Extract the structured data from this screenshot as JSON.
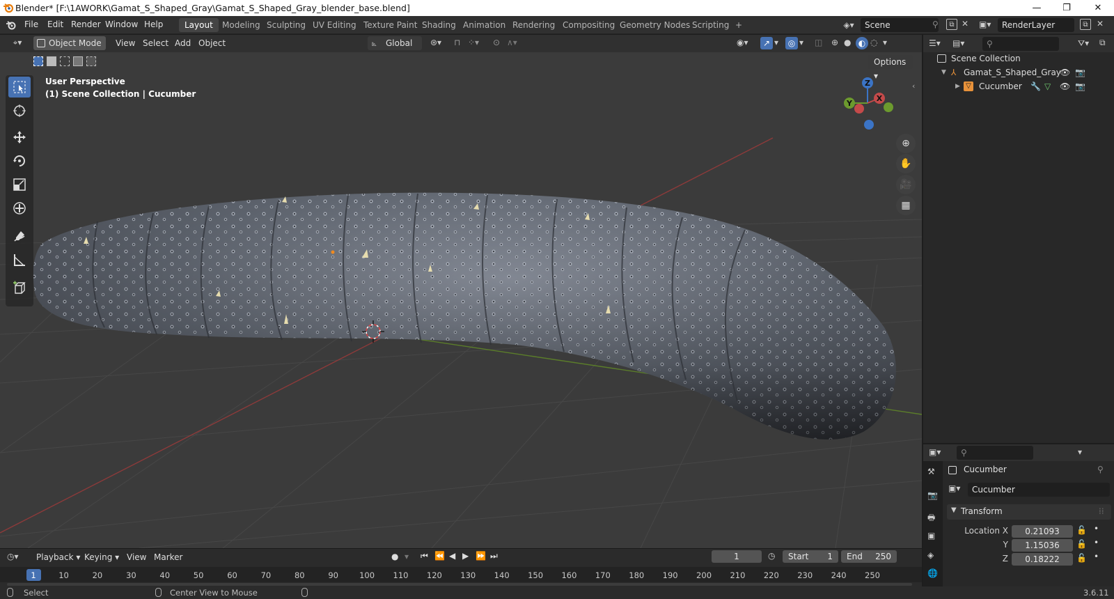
{
  "window": {
    "title": "Blender* [F:\\1AWORK\\Gamat_S_Shaped_Gray\\Gamat_S_Shaped_Gray_blender_base.blend]",
    "minimize": "—",
    "restore": "❐",
    "close": "✕"
  },
  "menu": [
    "File",
    "Edit",
    "Render",
    "Window",
    "Help"
  ],
  "workspaces": [
    "Layout",
    "Modeling",
    "Sculpting",
    "UV Editing",
    "Texture Paint",
    "Shading",
    "Animation",
    "Rendering",
    "Compositing",
    "Geometry Nodes",
    "Scripting"
  ],
  "workspace_add": "+",
  "scene": {
    "label": "Scene",
    "render_layer": "RenderLayer"
  },
  "viewport": {
    "mode": "Object Mode",
    "menus": [
      "View",
      "Select",
      "Add",
      "Object"
    ],
    "orientation": "Global",
    "options": "Options",
    "perspective": "User Perspective",
    "collection_info": "(1) Scene Collection | Cucumber",
    "gizmo": {
      "x": "X",
      "y": "Y",
      "z": "Z"
    }
  },
  "outliner": {
    "root": "Scene Collection",
    "items": [
      {
        "label": "Gamat_S_Shaped_Gray",
        "type": "armature"
      },
      {
        "label": "Cucumber",
        "type": "mesh"
      }
    ]
  },
  "properties": {
    "object_name": "Cucumber",
    "data_name": "Cucumber",
    "panel": "Transform",
    "location": {
      "label": "Location X",
      "y_label": "Y",
      "z_label": "Z",
      "x": "0.21093",
      "y": "1.15036",
      "z": "0.18222"
    }
  },
  "timeline": {
    "menus": [
      "Playback",
      "Keying",
      "View",
      "Marker"
    ],
    "current_frame": "1",
    "start_label": "Start",
    "start": "1",
    "end_label": "End",
    "end": "250",
    "ticks": [
      "1",
      "10",
      "20",
      "30",
      "40",
      "50",
      "60",
      "70",
      "80",
      "90",
      "100",
      "110",
      "120",
      "130",
      "140",
      "150",
      "160",
      "170",
      "180",
      "190",
      "200",
      "210",
      "220",
      "230",
      "240",
      "250"
    ]
  },
  "status": {
    "select": "Select",
    "center_view": "Center View to Mouse",
    "version": "3.6.11"
  },
  "colors": {
    "accent": "#4772b3",
    "x_axis": "#c44a4a",
    "y_axis": "#6c9a2e",
    "z_axis": "#3b74c6"
  }
}
